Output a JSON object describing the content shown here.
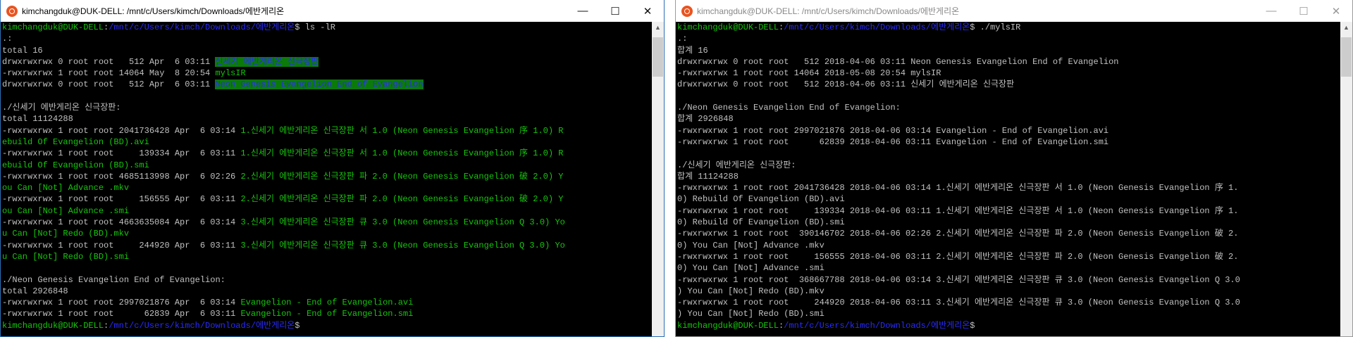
{
  "left": {
    "title": "kimchangduk@DUK-DELL: /mnt/c/Users/kimch/Downloads/에반게리온",
    "controls": {
      "minimize": "—",
      "maximize": "☐",
      "close": "✕"
    },
    "lines": [
      [
        {
          "t": "kimchangduk@DUK-DELL",
          "c": "user"
        },
        {
          "t": ":",
          "c": ""
        },
        {
          "t": "/mnt/c/Users/kimch/Downloads/에반게리온",
          "c": "path"
        },
        {
          "t": "$ ls -lR",
          "c": ""
        }
      ],
      [
        {
          "t": ".:",
          "c": ""
        }
      ],
      [
        {
          "t": "total 16",
          "c": ""
        }
      ],
      [
        {
          "t": "drwxrwxrwx 0 root root   512 Apr  6 03:11 ",
          "c": ""
        },
        {
          "t": "신세기 에반게리온 신극장판",
          "c": "dir"
        }
      ],
      [
        {
          "t": "-rwxrwxrwx 1 root root 14064 May  8 20:54 ",
          "c": ""
        },
        {
          "t": "mylsIR",
          "c": "exe"
        }
      ],
      [
        {
          "t": "drwxrwxrwx 0 root root   512 Apr  6 03:11 ",
          "c": ""
        },
        {
          "t": "Neon Genesis Evangelion End of Evangelion",
          "c": "dir"
        }
      ],
      [
        {
          "t": "",
          "c": ""
        }
      ],
      [
        {
          "t": "./신세기 에반게리온 신극장판:",
          "c": ""
        }
      ],
      [
        {
          "t": "total 11124288",
          "c": ""
        }
      ],
      [
        {
          "t": "-rwxrwxrwx 1 root root 2041736428 Apr  6 03:14 ",
          "c": ""
        },
        {
          "t": "1.신세기 에반게리온 신극장판 서 1.0 (Neon Genesis Evangelion 序 1.0) R",
          "c": "file"
        }
      ],
      [
        {
          "t": "ebuild Of Evangelion (BD).avi",
          "c": "file"
        }
      ],
      [
        {
          "t": "-rwxrwxrwx 1 root root     139334 Apr  6 03:11 ",
          "c": ""
        },
        {
          "t": "1.신세기 에반게리온 신극장판 서 1.0 (Neon Genesis Evangelion 序 1.0) R",
          "c": "file"
        }
      ],
      [
        {
          "t": "ebuild Of Evangelion (BD).smi",
          "c": "file"
        }
      ],
      [
        {
          "t": "-rwxrwxrwx 1 root root 4685113998 Apr  6 02:26 ",
          "c": ""
        },
        {
          "t": "2.신세기 에반게리온 신극장판 파 2.0 (Neon Genesis Evangelion 破 2.0) Y",
          "c": "file"
        }
      ],
      [
        {
          "t": "ou Can [Not] Advance .mkv",
          "c": "file"
        }
      ],
      [
        {
          "t": "-rwxrwxrwx 1 root root     156555 Apr  6 03:11 ",
          "c": ""
        },
        {
          "t": "2.신세기 에반게리온 신극장판 파 2.0 (Neon Genesis Evangelion 破 2.0) Y",
          "c": "file"
        }
      ],
      [
        {
          "t": "ou Can [Not] Advance .smi",
          "c": "file"
        }
      ],
      [
        {
          "t": "-rwxrwxrwx 1 root root 4663635084 Apr  6 03:14 ",
          "c": ""
        },
        {
          "t": "3.신세기 에반게리온 신극장판 큐 3.0 (Neon Genesis Evangelion Q 3.0) Yo",
          "c": "file"
        }
      ],
      [
        {
          "t": "u Can [Not] Redo (BD).mkv",
          "c": "file"
        }
      ],
      [
        {
          "t": "-rwxrwxrwx 1 root root     244920 Apr  6 03:11 ",
          "c": ""
        },
        {
          "t": "3.신세기 에반게리온 신극장판 큐 3.0 (Neon Genesis Evangelion Q 3.0) Yo",
          "c": "file"
        }
      ],
      [
        {
          "t": "u Can [Not] Redo (BD).smi",
          "c": "file"
        }
      ],
      [
        {
          "t": "",
          "c": ""
        }
      ],
      [
        {
          "t": "./Neon Genesis Evangelion End of Evangelion:",
          "c": ""
        }
      ],
      [
        {
          "t": "total 2926848",
          "c": ""
        }
      ],
      [
        {
          "t": "-rwxrwxrwx 1 root root 2997021876 Apr  6 03:14 ",
          "c": ""
        },
        {
          "t": "Evangelion - End of Evangelion.avi",
          "c": "file"
        }
      ],
      [
        {
          "t": "-rwxrwxrwx 1 root root      62839 Apr  6 03:11 ",
          "c": ""
        },
        {
          "t": "Evangelion - End of Evangelion.smi",
          "c": "file"
        }
      ],
      [
        {
          "t": "kimchangduk@DUK-DELL",
          "c": "user"
        },
        {
          "t": ":",
          "c": ""
        },
        {
          "t": "/mnt/c/Users/kimch/Downloads/에반게리온",
          "c": "path"
        },
        {
          "t": "$",
          "c": ""
        }
      ]
    ]
  },
  "right": {
    "title": "kimchangduk@DUK-DELL: /mnt/c/Users/kimch/Downloads/에반게리온",
    "controls": {
      "minimize": "—",
      "maximize": "☐",
      "close": "✕"
    },
    "lines": [
      [
        {
          "t": "kimchangduk@DUK-DELL",
          "c": "user"
        },
        {
          "t": ":",
          "c": ""
        },
        {
          "t": "/mnt/c/Users/kimch/Downloads/에반게리온",
          "c": "path"
        },
        {
          "t": "$ ./mylsIR",
          "c": ""
        }
      ],
      [
        {
          "t": ".:",
          "c": ""
        }
      ],
      [
        {
          "t": "합계 16",
          "c": ""
        }
      ],
      [
        {
          "t": "drwxrwxrwx 0 root root   512 2018-04-06 03:11 Neon Genesis Evangelion End of Evangelion",
          "c": ""
        }
      ],
      [
        {
          "t": "-rwxrwxrwx 1 root root 14064 2018-05-08 20:54 mylsIR",
          "c": ""
        }
      ],
      [
        {
          "t": "drwxrwxrwx 0 root root   512 2018-04-06 03:11 신세기 에반게리온 신극장판",
          "c": ""
        }
      ],
      [
        {
          "t": "",
          "c": ""
        }
      ],
      [
        {
          "t": "./Neon Genesis Evangelion End of Evangelion:",
          "c": ""
        }
      ],
      [
        {
          "t": "합계 2926848",
          "c": ""
        }
      ],
      [
        {
          "t": "-rwxrwxrwx 1 root root 2997021876 2018-04-06 03:14 Evangelion - End of Evangelion.avi",
          "c": ""
        }
      ],
      [
        {
          "t": "-rwxrwxrwx 1 root root      62839 2018-04-06 03:11 Evangelion - End of Evangelion.smi",
          "c": ""
        }
      ],
      [
        {
          "t": "",
          "c": ""
        }
      ],
      [
        {
          "t": "./신세기 에반게리온 신극장판:",
          "c": ""
        }
      ],
      [
        {
          "t": "합계 11124288",
          "c": ""
        }
      ],
      [
        {
          "t": "-rwxrwxrwx 1 root root 2041736428 2018-04-06 03:14 1.신세기 에반게리온 신극장판 서 1.0 (Neon Genesis Evangelion 序 1.",
          "c": ""
        }
      ],
      [
        {
          "t": "0) Rebuild Of Evangelion (BD).avi",
          "c": ""
        }
      ],
      [
        {
          "t": "-rwxrwxrwx 1 root root     139334 2018-04-06 03:11 1.신세기 에반게리온 신극장판 서 1.0 (Neon Genesis Evangelion 序 1.",
          "c": ""
        }
      ],
      [
        {
          "t": "0) Rebuild Of Evangelion (BD).smi",
          "c": ""
        }
      ],
      [
        {
          "t": "-rwxrwxrwx 1 root root  390146702 2018-04-06 02:26 2.신세기 에반게리온 신극장판 파 2.0 (Neon Genesis Evangelion 破 2.",
          "c": ""
        }
      ],
      [
        {
          "t": "0) You Can [Not] Advance .mkv",
          "c": ""
        }
      ],
      [
        {
          "t": "-rwxrwxrwx 1 root root     156555 2018-04-06 03:11 2.신세기 에반게리온 신극장판 파 2.0 (Neon Genesis Evangelion 破 2.",
          "c": ""
        }
      ],
      [
        {
          "t": "0) You Can [Not] Advance .smi",
          "c": ""
        }
      ],
      [
        {
          "t": "-rwxrwxrwx 1 root root  368667788 2018-04-06 03:14 3.신세기 에반게리온 신극장판 큐 3.0 (Neon Genesis Evangelion Q 3.0",
          "c": ""
        }
      ],
      [
        {
          "t": ") You Can [Not] Redo (BD).mkv",
          "c": ""
        }
      ],
      [
        {
          "t": "-rwxrwxrwx 1 root root     244920 2018-04-06 03:11 3.신세기 에반게리온 신극장판 큐 3.0 (Neon Genesis Evangelion Q 3.0",
          "c": ""
        }
      ],
      [
        {
          "t": ") You Can [Not] Redo (BD).smi",
          "c": ""
        }
      ],
      [
        {
          "t": "kimchangduk@DUK-DELL",
          "c": "user"
        },
        {
          "t": ":",
          "c": ""
        },
        {
          "t": "/mnt/c/Users/kimch/Downloads/에반게리온",
          "c": "path"
        },
        {
          "t": "$",
          "c": ""
        }
      ]
    ]
  },
  "scroll_up_glyph": "▲",
  "colors": {
    "user": "#16c60c",
    "path": "#2a2aff",
    "dir_bg": "#0b7a0b",
    "file": "#16c60c",
    "text": "#c0c0c0"
  }
}
